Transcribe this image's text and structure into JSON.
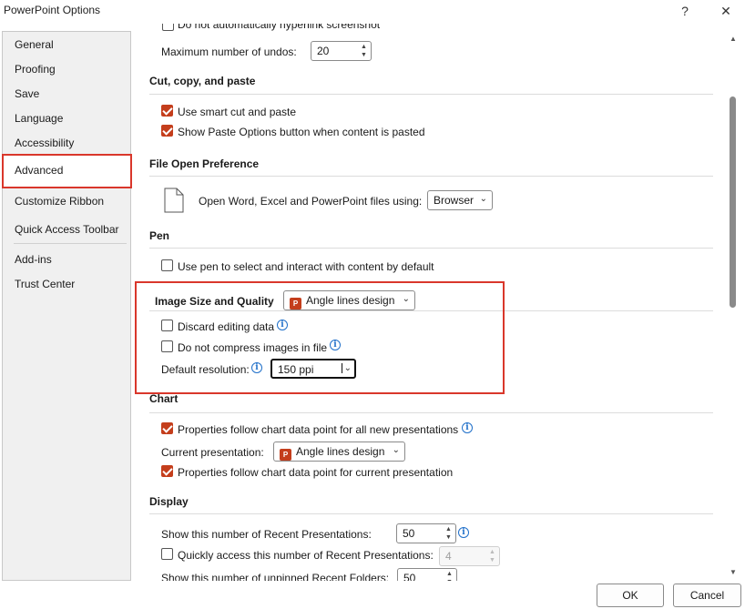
{
  "window": {
    "title": "PowerPoint Options",
    "help_glyph": "?",
    "close_glyph": "✕"
  },
  "sidebar": {
    "items": [
      {
        "label": "General"
      },
      {
        "label": "Proofing"
      },
      {
        "label": "Save"
      },
      {
        "label": "Language"
      },
      {
        "label": "Accessibility"
      },
      {
        "label": "Advanced",
        "selected": true
      },
      {
        "label": "Customize Ribbon"
      },
      {
        "label": "Quick Access Toolbar"
      },
      {
        "label": "Add-ins"
      },
      {
        "label": "Trust Center"
      }
    ]
  },
  "editing": {
    "partial_label": "Do not automatically hyperlink screenshot",
    "max_undos_label": "Maximum number of undos:",
    "max_undos_value": "20"
  },
  "cut_copy_paste": {
    "title": "Cut, copy, and paste",
    "smart_cut_label": "Use smart cut and paste",
    "smart_cut_checked": true,
    "paste_options_label": "Show Paste Options button when content is pasted",
    "paste_options_checked": true
  },
  "file_open": {
    "title": "File Open Preference",
    "open_using_label": "Open Word, Excel and PowerPoint files using:",
    "open_using_value": "Browser"
  },
  "pen": {
    "title": "Pen",
    "use_pen_label": "Use pen to select and interact with content by default",
    "use_pen_checked": false
  },
  "image_quality": {
    "title": "Image Size and Quality",
    "presentation_value": "Angle lines design",
    "discard_label": "Discard editing data",
    "discard_checked": false,
    "no_compress_label": "Do not compress images in file",
    "no_compress_checked": false,
    "resolution_label": "Default resolution:",
    "resolution_value": "150 ppi"
  },
  "chart": {
    "title": "Chart",
    "follow_all_label": "Properties follow chart data point for all new presentations",
    "follow_all_checked": true,
    "current_label": "Current presentation:",
    "current_value": "Angle lines design",
    "follow_current_label": "Properties follow chart data point for current presentation",
    "follow_current_checked": true
  },
  "display": {
    "title": "Display",
    "recent_label": "Show this number of Recent Presentations:",
    "recent_value": "50",
    "quick_access_label": "Quickly access this number of Recent Presentations:",
    "quick_access_checked": false,
    "quick_access_value": "4",
    "unpinned_label": "Show this number of unpinned Recent Folders:",
    "unpinned_value": "50"
  },
  "footer": {
    "ok_label": "OK",
    "cancel_label": "Cancel"
  },
  "icons": {
    "info_glyph": "i",
    "chevron_glyph": "⌄",
    "ppt_glyph": "P",
    "up_glyph": "▲",
    "down_glyph": "▼"
  },
  "colors": {
    "accent": "#c43e1c",
    "highlight_box": "#d9372b",
    "info": "#1f6fc9"
  }
}
